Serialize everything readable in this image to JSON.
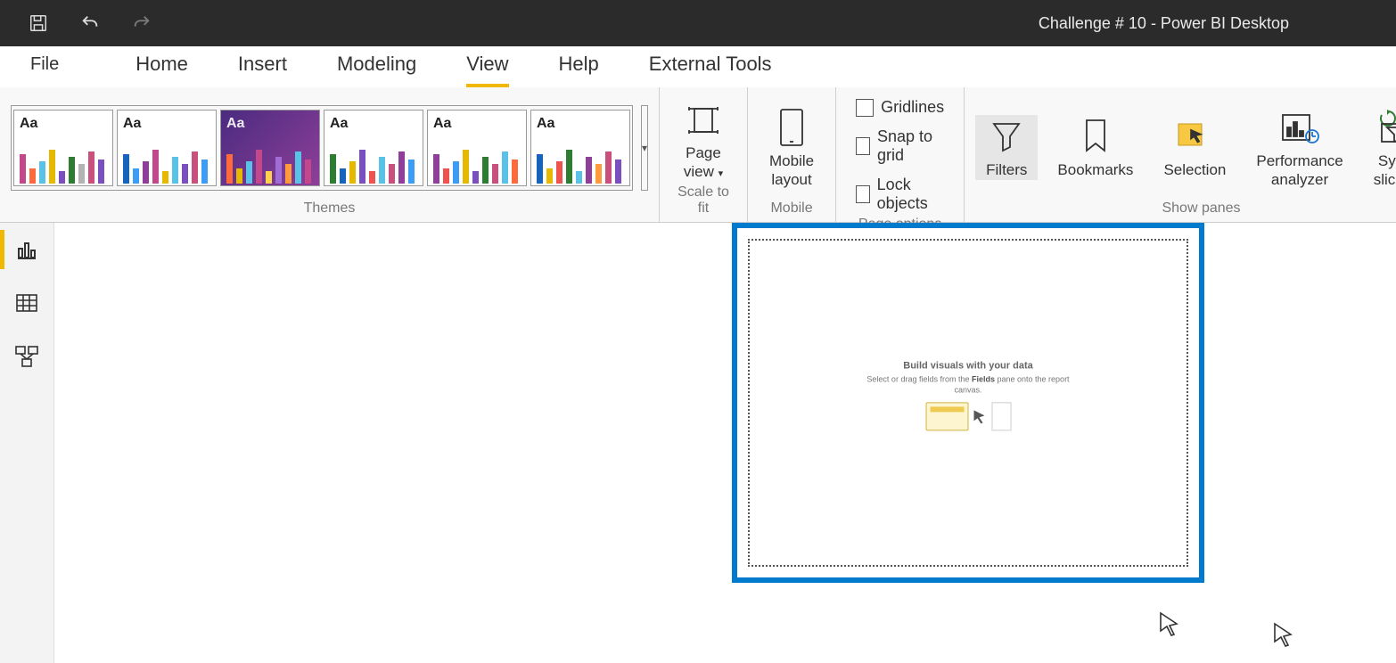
{
  "titlebar": {
    "title": "Challenge # 10 - Power BI Desktop"
  },
  "menu": {
    "file": "File",
    "home": "Home",
    "insert": "Insert",
    "modeling": "Modeling",
    "view": "View",
    "help": "Help",
    "external": "External Tools"
  },
  "ribbon": {
    "themes_label": "Themes",
    "scale_group": "Scale to fit",
    "mobile_group": "Mobile",
    "pageopt_group": "Page options",
    "showpanes_group": "Show panes",
    "page_view": "Page\nview",
    "mobile_layout": "Mobile\nlayout",
    "gridlines": "Gridlines",
    "snap": "Snap to grid",
    "lock": "Lock objects",
    "filters": "Filters",
    "bookmarks": "Bookmarks",
    "selection": "Selection",
    "perf": "Performance\nanalyzer",
    "sync": "Sync\nslicers",
    "theme_aa": "Aa"
  },
  "canvas": {
    "heading": "Build visuals with your data",
    "sub1": "Select or drag fields from the ",
    "sub_bold": "Fields",
    "sub2": " pane onto the report canvas."
  }
}
